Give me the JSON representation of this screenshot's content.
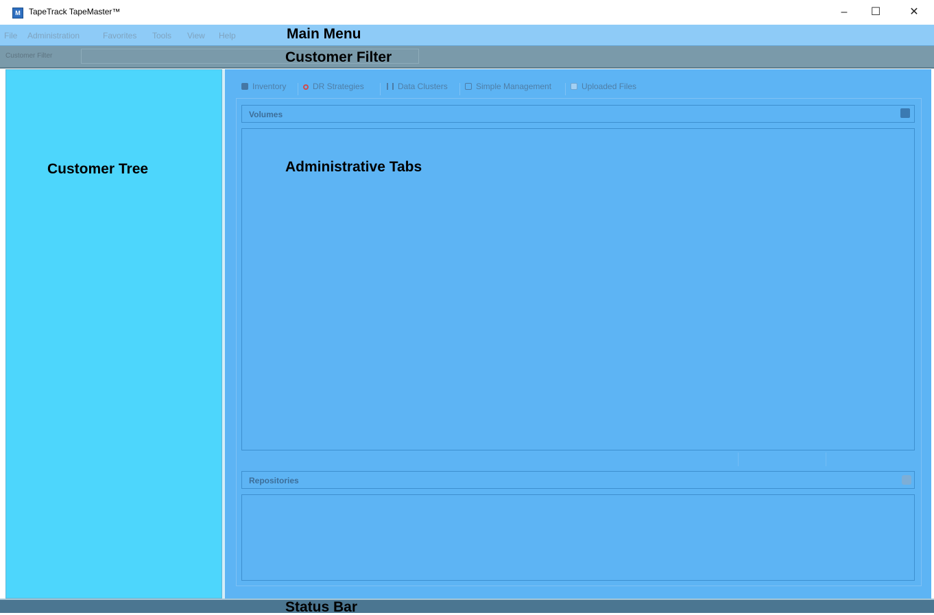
{
  "window": {
    "title": "TapeTrack TapeMaster™",
    "icon": "tapemaster-app-icon",
    "controls": {
      "minimize": "–",
      "maximize": "☐",
      "close": "✕"
    }
  },
  "menu": {
    "items": [
      "File",
      "Administration",
      "Favorites",
      "Tools",
      "View",
      "Help"
    ]
  },
  "customer_filter": {
    "label": "Customer Filter",
    "value": ""
  },
  "tabs": [
    {
      "label": "Inventory",
      "icon": "database-icon"
    },
    {
      "label": "DR Strategies",
      "icon": "lifebuoy-icon"
    },
    {
      "label": "Data Clusters",
      "icon": "cluster-icon"
    },
    {
      "label": "Simple Management",
      "icon": "management-icon"
    },
    {
      "label": "Uploaded Files",
      "icon": "file-icon"
    }
  ],
  "panels": {
    "volumes": {
      "title": "Volumes",
      "icon": "database-icon"
    },
    "repositories": {
      "title": "Repositories",
      "icon": "repository-icon"
    }
  },
  "annotations": {
    "main_menu": "Main Menu",
    "customer_filter": "Customer Filter",
    "customer_tree": "Customer Tree",
    "administrative_tabs": "Administrative Tabs",
    "status_bar": "Status Bar"
  },
  "colors": {
    "menu_region": "#8ecbf7",
    "filter_region": "#7a9aaa",
    "tree_region": "#4dd6fc",
    "admin_region": "#5db4f4",
    "status_region": "#4b7691"
  }
}
